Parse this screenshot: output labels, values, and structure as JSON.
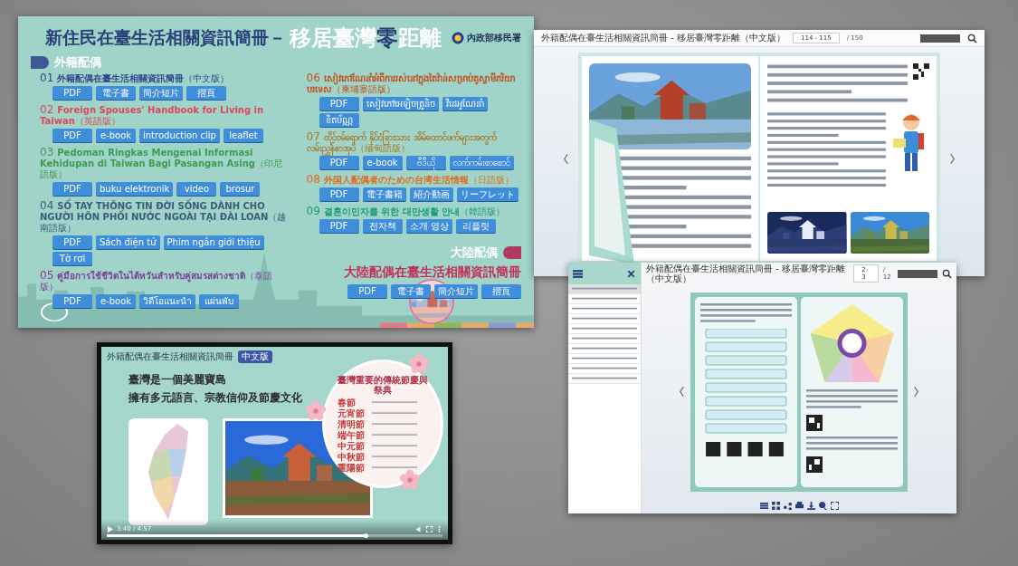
{
  "poster": {
    "title": "新住民在臺生活相關資訊簡冊－",
    "slogan_parts": [
      {
        "text": "移居臺灣",
        "accent": false
      },
      {
        "text": "零",
        "accent": true
      },
      {
        "text": "距離",
        "accent": false
      }
    ],
    "agency": "內政部移民署",
    "section": "外籍配偶",
    "items": [
      {
        "number": "01",
        "title": "外籍配偶在臺生活相關資訊簡冊",
        "edition": "（中文版）",
        "color": "#2c4a8a",
        "buttons": [
          "PDF",
          "電子書",
          "簡介短片",
          "摺頁"
        ]
      },
      {
        "number": "02",
        "title": "Foreign Spouses' Handbook for Living in Taiwan",
        "edition": "（英語版）",
        "color": "#e0455a",
        "buttons": [
          "PDF",
          "e-book",
          "introduction clip",
          "leaflet"
        ]
      },
      {
        "number": "03",
        "title": "Pedoman Ringkas Mengenai Informasi Kehidupan di Taiwan Bagi Pasangan Asing",
        "edition": "（印尼語版）",
        "color": "#3f9a55",
        "buttons": [
          "PDF",
          "buku elektronik",
          "video",
          "brosur"
        ]
      },
      {
        "number": "04",
        "title": "SỔ TAY THÔNG TIN ĐỜI SỐNG DÀNH CHO NGƯỜI HÔN PHỐI NƯỚC NGOÀI TẠI ĐÀI LOAN",
        "edition": "（越南語版）",
        "color": "#3e5b7a",
        "buttons": [
          "PDF",
          "Sách điện tử",
          "Phim ngắn giới thiệu",
          "Tờ rơi"
        ]
      },
      {
        "number": "05",
        "title": "คู่มือการใช้ชีวิตในไต้หวันสำหรับคู่สมรสต่างชาติ",
        "edition": "（泰語版）",
        "color": "#7b3f98",
        "buttons": [
          "PDF",
          "e-book",
          "วิดีโอแนะนำ",
          "แผ่นพับ"
        ]
      },
      {
        "number": "06",
        "title": "សៀវភៅណែនាំអំពីការរស់នៅក្នុងតៃវ៉ាន់សម្រាប់គូស្វាមីភរិយាបរទេស",
        "edition": "（柬埔寨語版）",
        "color": "#c0501e",
        "buttons": [
          "PDF",
          "សៀវភៅអេឡិចត្រូនិច",
          "វីដេអូណែនាំ",
          "ខិតប័ណ្ណ"
        ]
      },
      {
        "number": "07",
        "title": "ထိုင်ဝမ်ရောက် နိုင်ငံခြားသား အိမ်ထောင်ဖက်များအတွက် လမ်းညွှန်စာအုပ်",
        "edition": "（緬甸語版）",
        "color": "#a8782c",
        "buttons": [
          "PDF",
          "e-book",
          "ဗီဒီယို",
          "လက်ကမ်းစာစောင်"
        ]
      },
      {
        "number": "08",
        "title": "外国人配偶者のための台湾生活情報",
        "edition": "（日語版）",
        "color": "#e06a1e",
        "buttons": [
          "PDF",
          "電子書籍",
          "紹介動画",
          "リーフレット"
        ]
      },
      {
        "number": "09",
        "title": "결혼이민자를 위한 대만생활 안내",
        "edition": "（韓語版）",
        "color": "#1a9a7a",
        "buttons": [
          "PDF",
          "전자책",
          "소개 영상",
          "리플릿"
        ]
      }
    ],
    "mainland": {
      "section": "大陸配偶",
      "title": "大陸配偶在臺生活相關資訊簡冊",
      "color": "#c0305a",
      "buttons": [
        "PDF",
        "電子書",
        "簡介短片",
        "摺頁"
      ]
    }
  },
  "flipbook": {
    "title": "外籍配偶在臺生活相關資訊簡冊 - 移居臺灣零距離（中文版）",
    "page": "114 - 115",
    "total": "/ 150"
  },
  "flipbook_toc": {
    "title": "外籍配偶在臺生活相關資訊簡冊 - 移居臺灣零距離（中文版）",
    "page": "2-3",
    "total": "/ 12",
    "toc_items": [
      {
        "selected": true
      },
      {
        "selected": false
      },
      {
        "selected": false
      },
      {
        "selected": false
      },
      {
        "selected": false
      },
      {
        "selected": false
      },
      {
        "selected": false
      },
      {
        "selected": false
      },
      {
        "selected": false
      },
      {
        "selected": false
      }
    ]
  },
  "video": {
    "title": "外籍配偶在臺生活相關資訊簡冊",
    "badge": "中文版",
    "headline": [
      "臺灣是一個美麗寶島",
      "擁有多元語言、宗教信仰及節慶文化"
    ],
    "festival_title": "臺灣重要的傳統節慶與祭典",
    "festivals": [
      "春節",
      "元宵節",
      "清明節",
      "端午節",
      "中元節",
      "中秋節",
      "重陽節"
    ],
    "time": "3:40 / 4:57",
    "progress": {
      "level": 0.77
    }
  }
}
